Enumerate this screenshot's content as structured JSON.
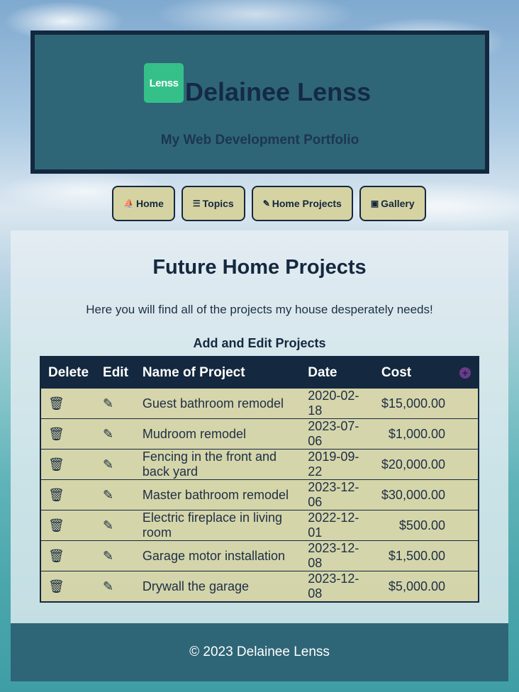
{
  "header": {
    "logo_text": "Lenss",
    "title": "Delainee Lenss",
    "subtitle": "My Web Development Portfolio"
  },
  "nav": [
    {
      "icon": "boat-icon",
      "glyph": "⛵",
      "label": "Home"
    },
    {
      "icon": "database-icon",
      "glyph": "☰",
      "label": "Topics"
    },
    {
      "icon": "hammer-icon",
      "glyph": "✎",
      "label": "Home Projects"
    },
    {
      "icon": "camera-icon",
      "glyph": "▣",
      "label": "Gallery"
    }
  ],
  "main": {
    "title": "Future Home Projects",
    "intro": "Here you will find all of the projects my house desperately needs!",
    "table_caption": "Add and Edit Projects",
    "columns": [
      "Delete",
      "Edit",
      "Name of Project",
      "Date",
      "Cost"
    ],
    "rows": [
      {
        "name": "Guest bathroom remodel",
        "date": "2020-02-18",
        "cost": "$15,000.00"
      },
      {
        "name": "Mudroom remodel",
        "date": "2023-07-06",
        "cost": "$1,000.00"
      },
      {
        "name": "Fencing in the front and back yard",
        "date": "2019-09-22",
        "cost": "$20,000.00"
      },
      {
        "name": "Master bathroom remodel",
        "date": "2023-12-06",
        "cost": "$30,000.00"
      },
      {
        "name": "Electric fireplace in living room",
        "date": "2022-12-01",
        "cost": "$500.00"
      },
      {
        "name": "Garage motor installation",
        "date": "2023-12-08",
        "cost": "$1,500.00"
      },
      {
        "name": "Drywall the garage",
        "date": "2023-12-08",
        "cost": "$5,000.00"
      }
    ]
  },
  "footer": {
    "text": "© 2023 Delainee Lenss"
  },
  "colors": {
    "header_bg": "#2e6677",
    "dark": "#14283f",
    "button_bg": "#d6d3a2",
    "logo": "#35c08a",
    "add_icon": "#6b3a8c"
  }
}
